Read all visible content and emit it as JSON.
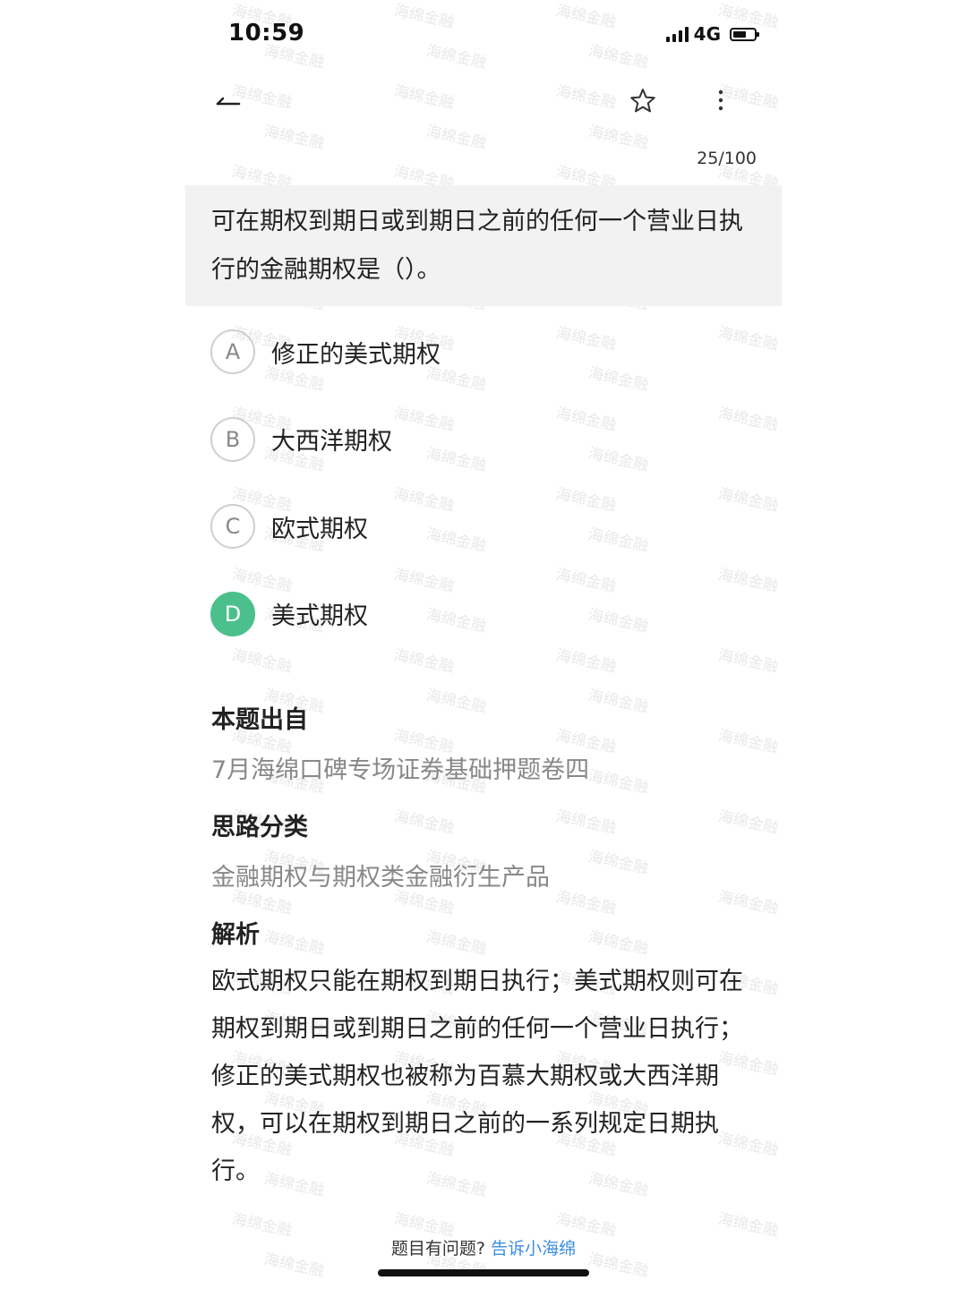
{
  "status_bar": {
    "time": "10:59",
    "network": "4G",
    "battery_level": 0.65,
    "signal_bars": 4
  },
  "nav": {
    "back_icon": "back-arrow-icon",
    "favorite_icon": "star-outline-icon",
    "more_icon": "more-vertical-icon",
    "progress": "25/100"
  },
  "question": {
    "text": "可在期权到期日或到期日之前的任何一个营业日执行的金融期权是（）。"
  },
  "options": [
    {
      "letter": "A",
      "text": "修正的美式期权",
      "selected": false
    },
    {
      "letter": "B",
      "text": "大西洋期权",
      "selected": false
    },
    {
      "letter": "C",
      "text": "欧式期权",
      "selected": false
    },
    {
      "letter": "D",
      "text": "美式期权",
      "selected": true
    }
  ],
  "source": {
    "label": "本题出自",
    "value": "7月海绵口碑专场证券基础押题卷四"
  },
  "category": {
    "label": "思路分类",
    "value": "金融期权与期权类金融衍生产品"
  },
  "analysis": {
    "label": "解析",
    "text": "欧式期权只能在期权到期日执行；美式期权则可在期权到期日或到期日之前的任何一个营业日执行；修正的美式期权也被称为百慕大期权或大西洋期权，可以在期权到期日之前的一系列规定日期执行。"
  },
  "footer": {
    "prompt": "题目有问题?",
    "link": "告诉小海绵"
  },
  "watermark": "海绵金融",
  "colors": {
    "selected_option": "#4cc08c",
    "link": "#3e8ee0",
    "question_bg": "#f2f2f2"
  }
}
